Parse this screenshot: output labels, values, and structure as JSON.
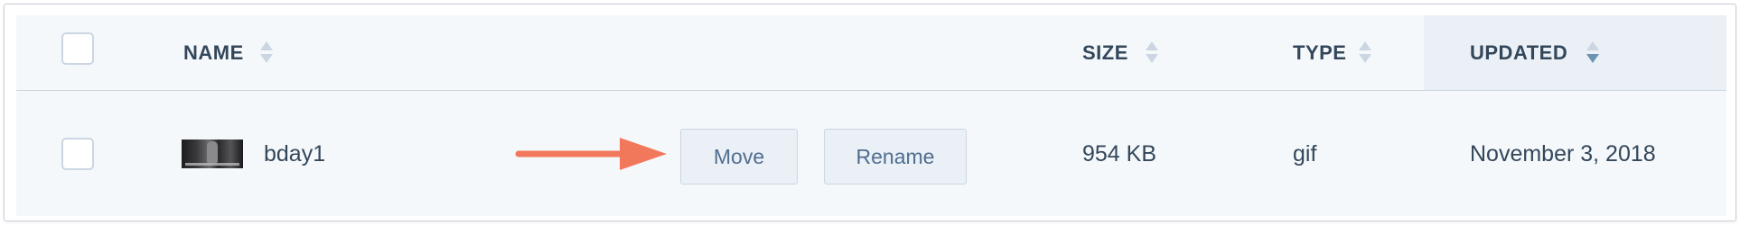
{
  "table": {
    "columns": {
      "name": "NAME",
      "size": "SIZE",
      "type": "TYPE",
      "updated": "UPDATED"
    },
    "sorted_column": "updated",
    "rows": [
      {
        "name": "bday1",
        "size": "954 KB",
        "type": "gif",
        "updated": "November 3, 2018",
        "actions": {
          "move": "Move",
          "rename": "Rename"
        }
      }
    ]
  },
  "colors": {
    "header_bg": "#f5f8fa",
    "sorted_header_bg": "#eaf0f6",
    "button_bg": "#eaf0f6",
    "arrow": "#f2785c",
    "text": "#33475b"
  },
  "icons": {
    "sort": "sort-arrows-icon",
    "annotation": "arrow-right-icon"
  }
}
